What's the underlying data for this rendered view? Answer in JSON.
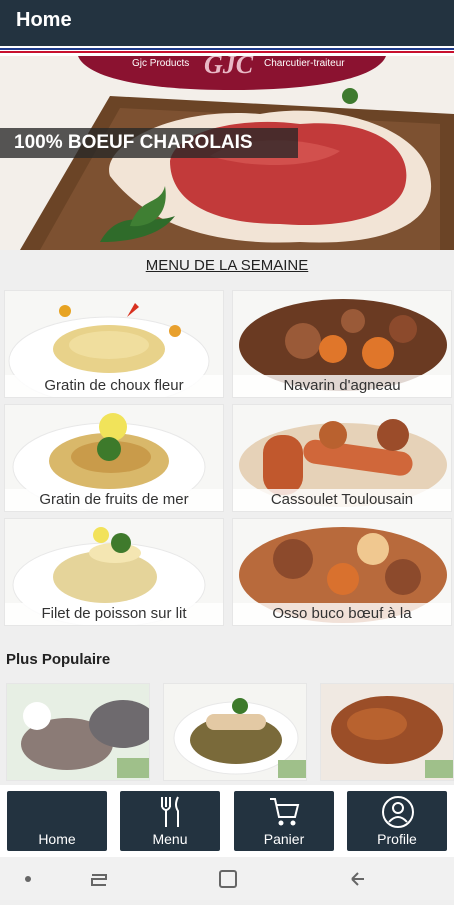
{
  "header": {
    "title": "Home"
  },
  "banner": {
    "brand_left": "Gjc Products",
    "brand_logo": "GJC",
    "brand_right": "Charcutier-traiteur",
    "hero_label": "100% BOEUF CHAROLAIS"
  },
  "menu": {
    "title": "MENU DE LA SEMAINE",
    "items": [
      {
        "label": "Gratin de choux fleur"
      },
      {
        "label": "Navarin d'agneau"
      },
      {
        "label": "Gratin de fruits de mer"
      },
      {
        "label": "Cassoulet Toulousain"
      },
      {
        "label": "Filet de poisson sur lit"
      },
      {
        "label": "Osso buco bœuf à la"
      }
    ]
  },
  "popular": {
    "title": "Plus Populaire"
  },
  "nav": {
    "items": [
      {
        "label": "Home",
        "icon": "home"
      },
      {
        "label": "Menu",
        "icon": "fork-knife-icon"
      },
      {
        "label": "Panier",
        "icon": "cart-icon"
      },
      {
        "label": "Profile",
        "icon": "user-icon"
      }
    ]
  },
  "colors": {
    "nav_bg": "#233340",
    "brand_red": "#8b1230"
  }
}
